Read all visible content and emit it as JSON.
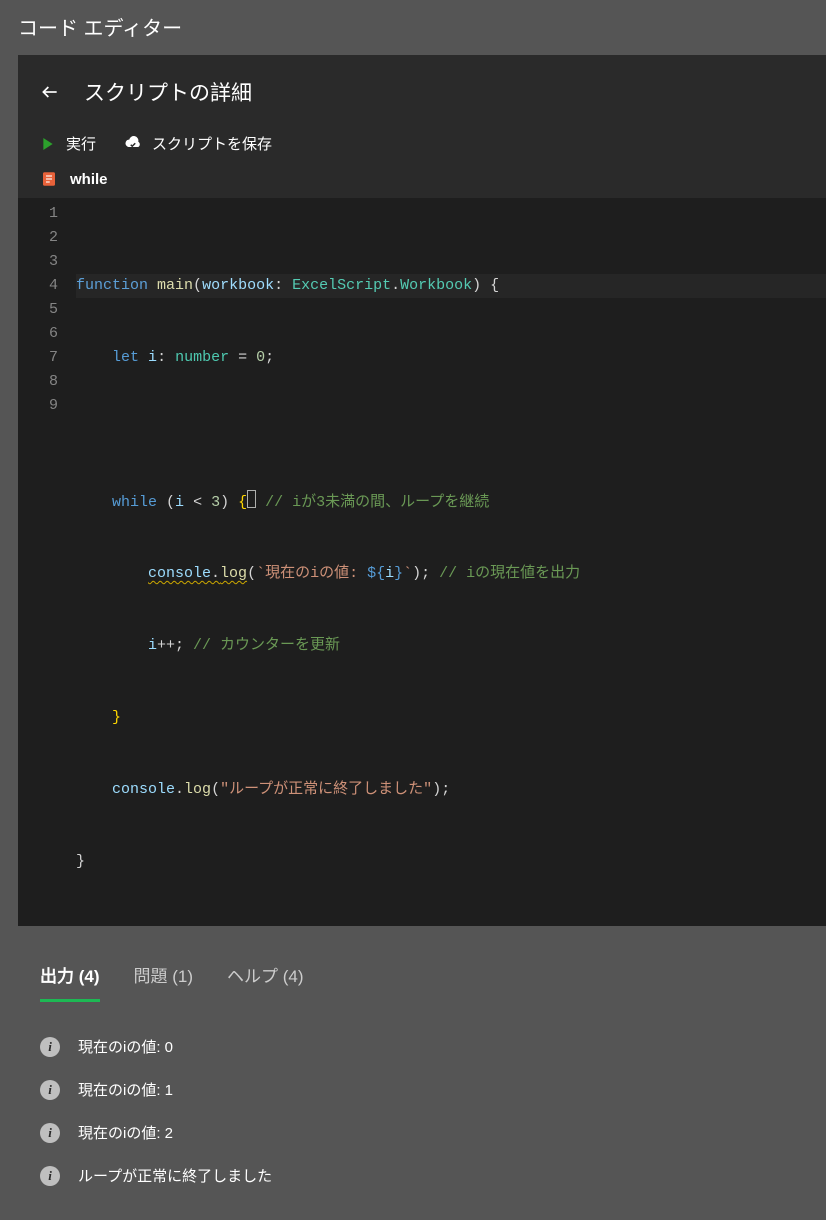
{
  "app": {
    "title": "コード エディター"
  },
  "header": {
    "title": "スクリプトの詳細"
  },
  "toolbar": {
    "run": "実行",
    "save": "スクリプトを保存"
  },
  "file": {
    "name": "while"
  },
  "code": {
    "lineCount": 9,
    "lines": {
      "l1": {
        "a": "function",
        "b": " ",
        "c": "main",
        "d": "(",
        "e": "workbook",
        "f": ": ",
        "g": "ExcelScript",
        "h": ".",
        "i": "Workbook",
        "j": ") {"
      },
      "l2": {
        "a": "    ",
        "b": "let",
        "c": " ",
        "d": "i",
        "e": ": ",
        "f": "number",
        "g": " = ",
        "h": "0",
        "i": ";"
      },
      "l3": {
        "a": ""
      },
      "l4": {
        "a": "    ",
        "b": "while",
        "c": " (",
        "d": "i",
        "e": " < ",
        "f": "3",
        "g": ") ",
        "h": "{",
        "i": " ",
        "j": "// iが3未満の間、ループを継続"
      },
      "l5": {
        "a": "        ",
        "b": "console",
        "c": ".",
        "d": "log",
        "e": "(",
        "f": "`現在のiの値: ",
        "g": "${",
        "h": "i",
        "i": "}",
        "j": "`",
        "k": "); ",
        "l": "// iの現在値を出力"
      },
      "l6": {
        "a": "        ",
        "b": "i",
        "c": "++; ",
        "d": "// カウンターを更新"
      },
      "l7": {
        "a": "    ",
        "b": "}"
      },
      "l8": {
        "a": "    ",
        "b": "console",
        "c": ".",
        "d": "log",
        "e": "(",
        "f": "\"ループが正常に終了しました\"",
        "g": ");"
      },
      "l9": {
        "a": "}"
      }
    }
  },
  "tabs": {
    "output": "出力 (4)",
    "problems": "問題 (1)",
    "help": "ヘルプ (4)"
  },
  "output": [
    "現在のiの値: 0",
    "現在のiの値: 1",
    "現在のiの値: 2",
    "ループが正常に終了しました"
  ]
}
